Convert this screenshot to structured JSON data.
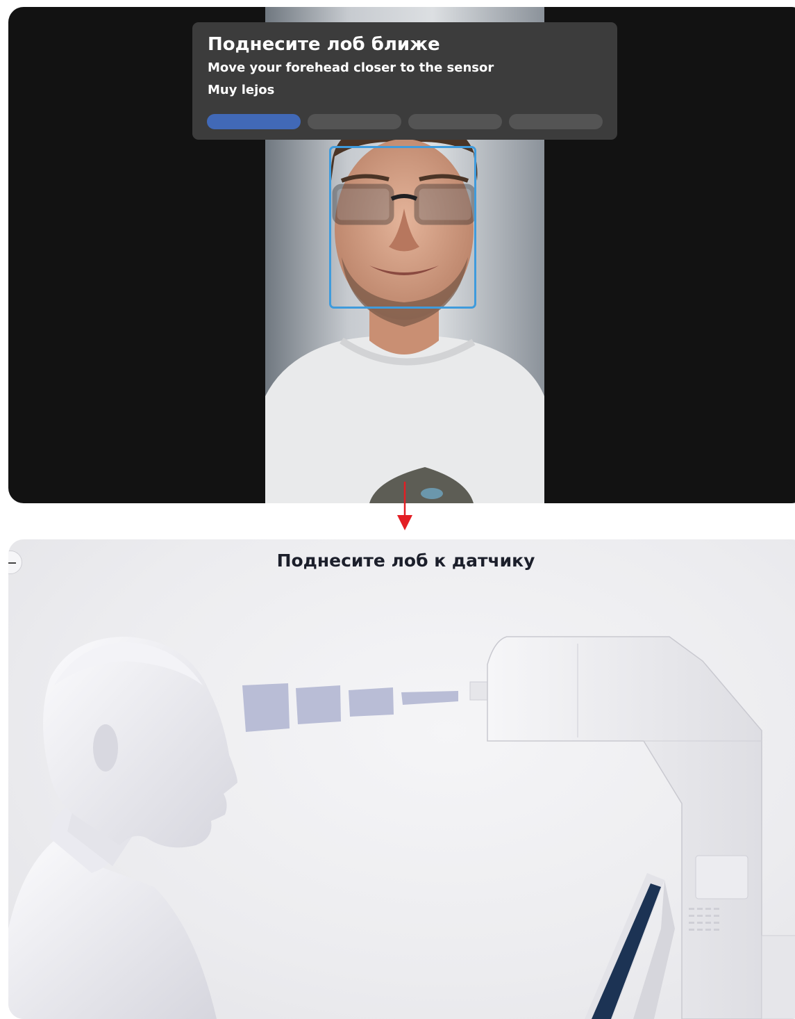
{
  "camera_screen": {
    "prompt": {
      "title": "Поднесите лоб ближе",
      "subtitle_en": "Move your forehead closer to the sensor",
      "subtitle_es": "Muy lejos"
    },
    "progress": {
      "total_steps": 4,
      "completed_steps": 1,
      "active_color": "#4169b7",
      "inactive_color": "#545454"
    },
    "face_frame_color": "#3f9bdc"
  },
  "arrow_color": "#e31e24",
  "instruction_screen": {
    "title": "Поднесите лоб к датчику",
    "back_icon": "minus-icon",
    "beam_color": "#b9bdd6"
  }
}
